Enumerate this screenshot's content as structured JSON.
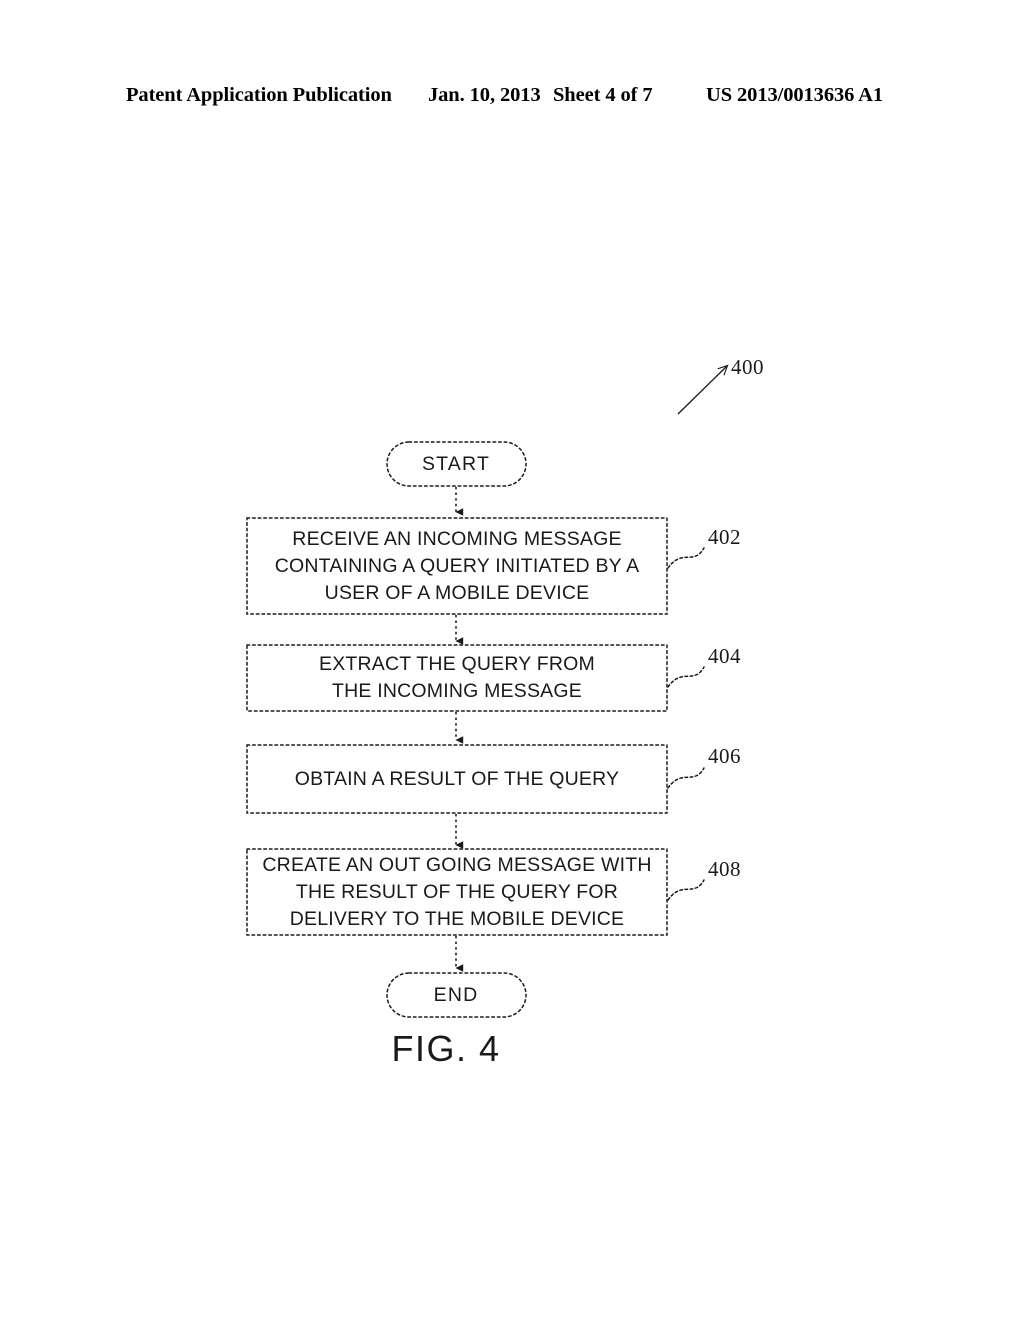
{
  "header": {
    "publication": "Patent Application Publication",
    "date": "Jan. 10, 2013",
    "sheet": "Sheet 4 of 7",
    "patent_number": "US 2013/0013636 A1"
  },
  "figure": {
    "caption": "FIG. 4",
    "figure_reference": "400",
    "type": "flowchart",
    "line_style": "dotted",
    "stroke_color": "#1a1a1a",
    "fill_color": "#ffffff",
    "nodes": [
      {
        "id": "start",
        "shape": "terminal-rounded",
        "label": "START",
        "lines": [
          "START"
        ],
        "ref": ""
      },
      {
        "id": "step-402",
        "shape": "process-rectangle",
        "ref": "402",
        "lines": [
          "RECEIVE AN INCOMING MESSAGE",
          "CONTAINING A QUERY INITIATED BY A",
          "USER OF A MOBILE DEVICE"
        ]
      },
      {
        "id": "step-404",
        "shape": "process-rectangle",
        "ref": "404",
        "lines": [
          "EXTRACT THE QUERY FROM",
          "THE INCOMING MESSAGE"
        ]
      },
      {
        "id": "step-406",
        "shape": "process-rectangle",
        "ref": "406",
        "lines": [
          "OBTAIN A RESULT OF THE QUERY"
        ]
      },
      {
        "id": "step-408",
        "shape": "process-rectangle",
        "ref": "408",
        "lines": [
          "CREATE AN OUT GOING MESSAGE WITH",
          "THE RESULT OF THE QUERY FOR",
          "DELIVERY TO THE MOBILE DEVICE"
        ]
      },
      {
        "id": "end",
        "shape": "terminal-rounded",
        "label": "END",
        "lines": [
          "END"
        ],
        "ref": ""
      }
    ],
    "connectors": [
      {
        "from": "start",
        "to": "step-402",
        "style": "dotted-arrow"
      },
      {
        "from": "step-402",
        "to": "step-404",
        "style": "dotted-arrow"
      },
      {
        "from": "step-404",
        "to": "step-406",
        "style": "dotted-arrow"
      },
      {
        "from": "step-406",
        "to": "step-408",
        "style": "dotted-arrow"
      },
      {
        "from": "step-408",
        "to": "end",
        "style": "dotted-arrow"
      }
    ]
  }
}
